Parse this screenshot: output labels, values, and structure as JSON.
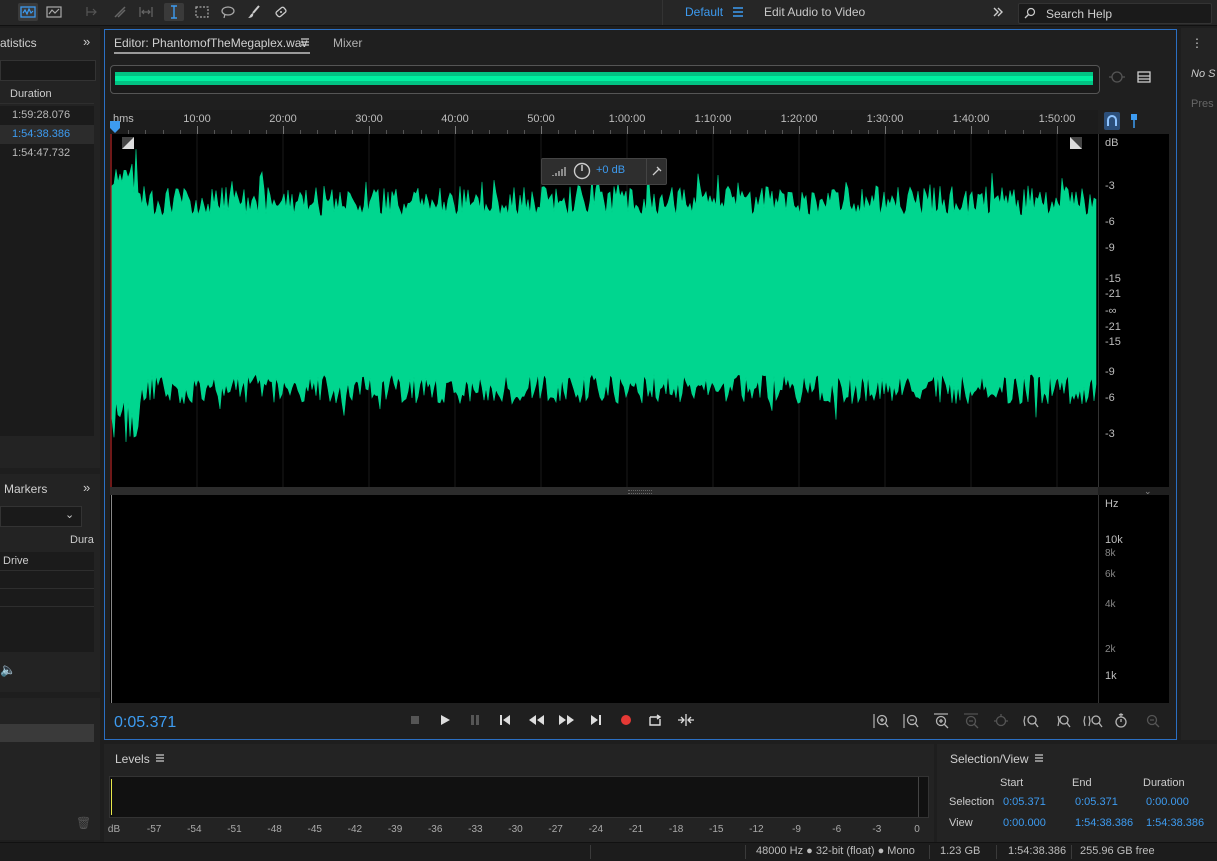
{
  "toolbar": {
    "workspace": "Default",
    "edit_audio_to_video": "Edit Audio to Video",
    "search_placeholder": "Search Help"
  },
  "left_panel": {
    "title": "atistics",
    "duration_header": "Duration",
    "rows": [
      "1:59:28.076",
      "1:54:38.386",
      "1:54:47.732"
    ],
    "selected_row_index": 1,
    "markers_title": "Markers",
    "markers_col_header": "Dura",
    "markers_row": "Drive"
  },
  "right_panel": {
    "text1": "No S",
    "text2": "Pres"
  },
  "editor": {
    "tab_label": "Editor: PhantomofTheMegaplex.wav",
    "mixer_tab": "Mixer",
    "ruler_unit": "hms",
    "ruler_ticks": [
      "10:00",
      "20:00",
      "30:00",
      "40:00",
      "50:00",
      "1:00:00",
      "1:10:00",
      "1:20:00",
      "1:30:00",
      "1:40:00",
      "1:50:00"
    ],
    "db_scale": [
      "dB",
      "-3",
      "-6",
      "-9",
      "-15",
      "-21",
      "-∞",
      "-21",
      "-15",
      "-9",
      "-6",
      "-3"
    ],
    "hz_scale": [
      "Hz",
      "10k",
      "8k",
      "6k",
      "4k",
      "2k",
      "1k"
    ],
    "hud_gain": "+0 dB",
    "timecode": "0:05.371",
    "waveform_color": "#00d68f"
  },
  "levels": {
    "title": "Levels",
    "scale": [
      "dB",
      "-57",
      "-54",
      "-51",
      "-48",
      "-45",
      "-42",
      "-39",
      "-36",
      "-33",
      "-30",
      "-27",
      "-24",
      "-21",
      "-18",
      "-15",
      "-12",
      "-9",
      "-6",
      "-3",
      "0"
    ]
  },
  "selection_view": {
    "title": "Selection/View",
    "col_start": "Start",
    "col_end": "End",
    "col_duration": "Duration",
    "selection_label": "Selection",
    "selection_start": "0:05.371",
    "selection_end": "0:05.371",
    "selection_duration": "0:00.000",
    "view_label": "View",
    "view_start": "0:00.000",
    "view_end": "1:54:38.386",
    "view_duration": "1:54:38.386"
  },
  "status": {
    "format": "48000 Hz ● 32-bit (float) ● Mono",
    "size": "1.23 GB",
    "duration": "1:54:38.386",
    "free": "255.96 GB free"
  },
  "colors": {
    "accent": "#3d9bf0",
    "waveform": "#00d68f",
    "record": "#e53935"
  }
}
